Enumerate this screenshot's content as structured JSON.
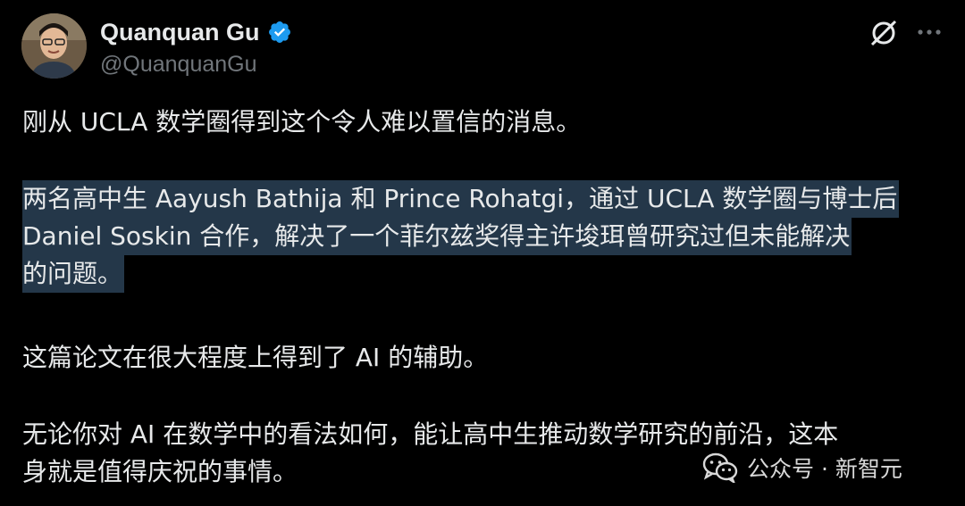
{
  "author": {
    "display_name": "Quanquan Gu",
    "handle": "@QuanquanGu"
  },
  "tweet": {
    "p1": "刚从 UCLA 数学圈得到这个令人难以置信的消息。",
    "p2_lines": [
      "两名高中生 Aayush Bathija 和 Prince Rohatgi，通过 UCLA 数学圈与博士后",
      "Daniel Soskin 合作，解决了一个菲尔兹奖得主许埈珥曾研究过但未能解决",
      "的问题。"
    ],
    "p3": "这篇论文在很大程度上得到了 AI 的辅助。",
    "p4_lines": [
      "无论你对 AI 在数学中的看法如何，能让高中生推动数学研究的前沿，这本",
      "身就是值得庆祝的事情。"
    ]
  },
  "watermark": {
    "text": "公众号 · 新智元"
  },
  "icons": {
    "verified": "verified-badge-icon",
    "grok": "grok-icon",
    "more": "more-options-icon",
    "wechat": "wechat-icon"
  },
  "colors": {
    "background": "#000000",
    "text": "#e7e9ea",
    "secondary": "#71767b",
    "highlight": "#243749",
    "verified": "#1d9bf0"
  }
}
